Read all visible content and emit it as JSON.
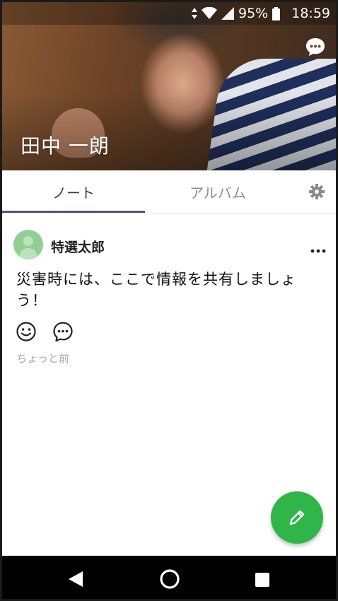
{
  "status_bar": {
    "battery": "95%",
    "time": "18:59"
  },
  "profile": {
    "name": "田中 一朗"
  },
  "tabs": [
    {
      "label": "ノート",
      "active": true
    },
    {
      "label": "アルバム",
      "active": false
    }
  ],
  "post": {
    "author": "特選太郎",
    "text": "災害時には、ここで情報を共有しましょう！",
    "time": "ちょっと前"
  },
  "icons": {
    "chat": "chat-bubble-icon",
    "settings": "gear-icon",
    "more": "more-dots-icon",
    "react": "smiley-icon",
    "comment": "comment-icon",
    "compose": "pencil-icon"
  },
  "colors": {
    "accent": "#2fb548",
    "tab_active": "#4d5570",
    "avatar_bg": "#8fcf93"
  }
}
